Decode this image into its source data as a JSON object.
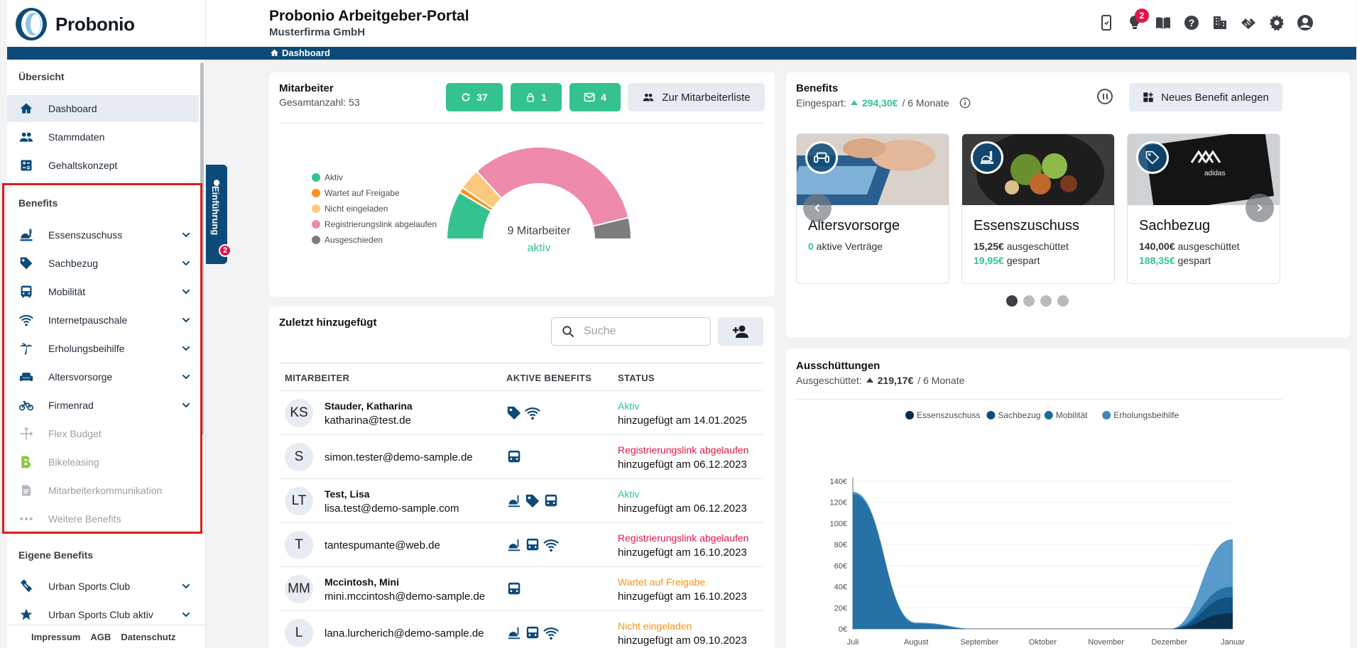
{
  "brand": {
    "name": "Probonio"
  },
  "header": {
    "title": "Probonio Arbeitgeber-Portal",
    "company": "Musterfirma GmbH",
    "notification_count": "2"
  },
  "breadcrumb": {
    "current": "Dashboard"
  },
  "sidebar": {
    "overview_title": "Übersicht",
    "overview_items": [
      {
        "label": "Dashboard",
        "icon": "home-icon",
        "active": true
      },
      {
        "label": "Stammdaten",
        "icon": "people-icon"
      },
      {
        "label": "Gehaltskonzept",
        "icon": "calculator-icon"
      }
    ],
    "benefits_title": "Benefits",
    "benefit_items": [
      {
        "label": "Essenszuschuss",
        "icon": "food-icon",
        "expandable": true
      },
      {
        "label": "Sachbezug",
        "icon": "tag-icon",
        "expandable": true
      },
      {
        "label": "Mobilität",
        "icon": "bus-icon",
        "expandable": true
      },
      {
        "label": "Internetpauschale",
        "icon": "wifi-icon",
        "expandable": true
      },
      {
        "label": "Erholungsbeihilfe",
        "icon": "palm-tree-icon",
        "expandable": true
      },
      {
        "label": "Altersvorsorge",
        "icon": "couch-icon",
        "expandable": true
      },
      {
        "label": "Firmenrad",
        "icon": "bike-icon",
        "expandable": true
      },
      {
        "label": "Flex Budget",
        "icon": "flex-icon",
        "disabled": true
      },
      {
        "label": "Bikeleasing",
        "icon": "bikeleasing-icon",
        "disabled": true
      },
      {
        "label": "Mitarbeiterkommunikation",
        "icon": "document-icon",
        "disabled": true
      },
      {
        "label": "Weitere Benefits",
        "icon": "more-icon",
        "disabled": true
      }
    ],
    "own_title": "Eigene Benefits",
    "own_items": [
      {
        "label": "Urban Sports Club",
        "icon": "dumbbell-icon"
      },
      {
        "label": "Urban Sports Club aktiv",
        "icon": "star-icon"
      }
    ],
    "footer": {
      "impressum": "Impressum",
      "agb": "AGB",
      "datenschutz": "Datenschutz"
    },
    "intro_tab": {
      "label": "Einführung",
      "badge": "2"
    }
  },
  "employees_card": {
    "title": "Mitarbeiter",
    "subtitle": "Gesamtanzahl: 53",
    "btn_refresh": "37",
    "btn_lock": "1",
    "btn_mail": "4",
    "btn_list": "Zur Mitarbeiterliste",
    "gauge_label": "9 Mitarbeiter",
    "gauge_sub": "aktiv",
    "legend": [
      {
        "label": "Aktiv",
        "color": "#34c38f"
      },
      {
        "label": "Wartet auf Freigabe",
        "color": "#f7941d"
      },
      {
        "label": "Nicht eingeladen",
        "color": "#fcc97c"
      },
      {
        "label": "Registrierungslink abgelaufen",
        "color": "#ee8aab"
      },
      {
        "label": "Ausgeschieden",
        "color": "#7d7d7d"
      }
    ],
    "gauge": [
      {
        "name": "Aktiv",
        "value": 9,
        "color": "#34c38f"
      },
      {
        "name": "Wartet auf Freigabe",
        "value": 1,
        "color": "#f7941d"
      },
      {
        "name": "Nicht eingeladen",
        "value": 4,
        "color": "#fcc97c"
      },
      {
        "name": "Registrierungslink abgelaufen",
        "value": 35,
        "color": "#ee8aab"
      },
      {
        "name": "Ausgeschieden",
        "value": 4,
        "color": "#7d7d7d"
      }
    ]
  },
  "recent_card": {
    "title": "Zuletzt hinzugefügt",
    "search_placeholder": "Suche",
    "columns": [
      "MITARBEITER",
      "AKTIVE BENEFITS",
      "STATUS"
    ],
    "rows": [
      {
        "initials": "KS",
        "name": "Stauder, Katharina",
        "email": "katharina@test.de",
        "benefits": [
          "tag",
          "wifi"
        ],
        "status": "Aktiv",
        "status_color": "#34c38f",
        "date": "hinzugefügt am 14.01.2025"
      },
      {
        "initials": "S",
        "name": "",
        "email": "simon.tester@demo-sample.de",
        "benefits": [
          "bus"
        ],
        "status": "Registrierungslink abgelaufen",
        "status_color": "#e1154a",
        "date": "hinzugefügt am 06.12.2023"
      },
      {
        "initials": "LT",
        "name": "Test, Lisa",
        "email": "lisa.test@demo-sample.com",
        "benefits": [
          "food",
          "tag",
          "bus"
        ],
        "status": "Aktiv",
        "status_color": "#34c38f",
        "date": "hinzugefügt am 06.12.2023"
      },
      {
        "initials": "T",
        "name": "",
        "email": "tantespumante@web.de",
        "benefits": [
          "food",
          "bus",
          "wifi"
        ],
        "status": "Registrierungslink abgelaufen",
        "status_color": "#e1154a",
        "date": "hinzugefügt am 16.10.2023"
      },
      {
        "initials": "MM",
        "name": "Mccintosh, Mini",
        "email": "mini.mccintosh@demo-sample.de",
        "benefits": [
          "bus"
        ],
        "status": "Wartet auf Freigabe",
        "status_color": "#f7941d",
        "date": "hinzugefügt am 16.10.2023"
      },
      {
        "initials": "L",
        "name": "",
        "email": "lana.lurcherich@demo-sample.de",
        "benefits": [
          "food",
          "bus",
          "wifi"
        ],
        "status": "Nicht eingeladen",
        "status_color": "#f7941d",
        "date": "hinzugefügt am 09.10.2023"
      }
    ]
  },
  "benefits_card": {
    "title": "Benefits",
    "saved_label": "Eingespart:",
    "saved_value": "294,30€",
    "saved_period": "/ 6 Monate",
    "new_btn": "Neues Benefit anlegen",
    "items": [
      {
        "name": "Altersvorsorge",
        "l1a": "0",
        "l1b": " aktive Verträge",
        "l2a": "",
        "l2b": ""
      },
      {
        "name": "Essenszuschuss",
        "l1a": "15,25€",
        "l1b": " ausgeschüttet",
        "l2a": "19,95€",
        "l2b": " gespart"
      },
      {
        "name": "Sachbezug",
        "l1a": "140,00€",
        "l1b": " ausgeschüttet",
        "l2a": "188,35€",
        "l2b": " gespart"
      }
    ],
    "page_count": 4,
    "active_page": 0
  },
  "payout_card": {
    "title": "Ausschüttungen",
    "sub_label": "Ausgeschüttet:",
    "sub_value": "219,17€",
    "sub_period": "/ 6 Monate"
  },
  "chart_data": {
    "type": "area",
    "categories": [
      "Juli",
      "August",
      "September",
      "Oktober",
      "November",
      "Dezember",
      "Januar"
    ],
    "yticks": [
      "0€",
      "20€",
      "40€",
      "60€",
      "80€",
      "100€",
      "120€",
      "140€"
    ],
    "ylim": [
      0,
      140
    ],
    "legend_position": "top",
    "series": [
      {
        "name": "Essenszuschuss",
        "color": "#0b2a45",
        "values": [
          0,
          0,
          0,
          0,
          0,
          0,
          15
        ]
      },
      {
        "name": "Sachbezug",
        "color": "#0f4c7d",
        "values": [
          0,
          0,
          0,
          0,
          0,
          0,
          30
        ]
      },
      {
        "name": "Mobilität",
        "color": "#1d6aa0",
        "values": [
          128,
          5,
          0,
          0,
          0,
          0,
          40
        ]
      },
      {
        "name": "Erholungsbeihilfe",
        "color": "#3b88bf",
        "values": [
          130,
          6,
          0,
          0,
          0,
          0,
          85
        ]
      }
    ]
  }
}
